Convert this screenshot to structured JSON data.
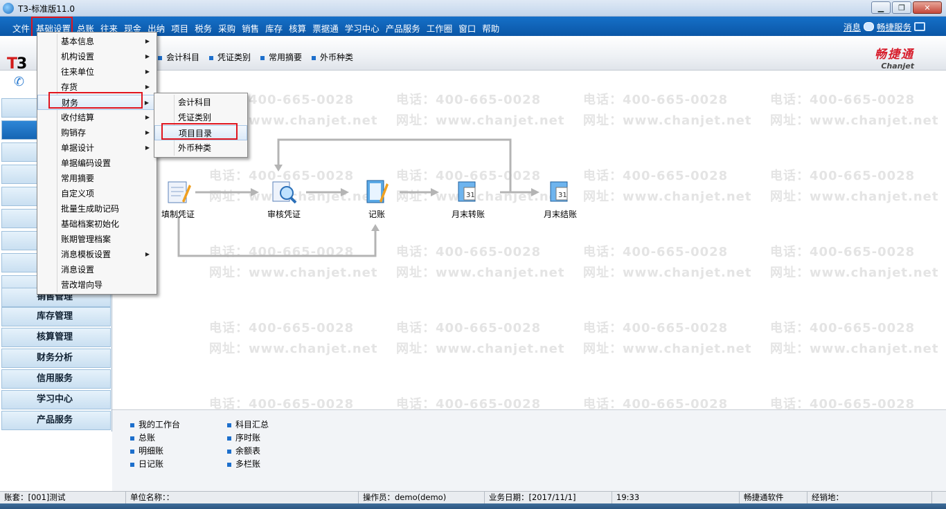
{
  "window": {
    "title": "T3-标准版11.0",
    "min": "▁",
    "max": "❐",
    "close": "✕"
  },
  "menubar": {
    "items": [
      "文件",
      "基础设置",
      "总账",
      "往来",
      "现金",
      "出纳",
      "项目",
      "税务",
      "采购",
      "销售",
      "库存",
      "核算",
      "票据通",
      "学习中心",
      "产品服务",
      "工作圈",
      "窗口",
      "帮助"
    ],
    "messages": "消息",
    "service": "畅捷服务"
  },
  "toolbar": {
    "items": [
      "会计科目",
      "凭证类别",
      "常用摘要",
      "外币种类"
    ],
    "brand_cn": "畅捷通",
    "brand_en": "Chanjet",
    "logo_t": "T",
    "logo_3": "3"
  },
  "sidebar": {
    "items": [
      "销售管理",
      "库存管理",
      "核算管理",
      "财务分析",
      "信用服务",
      "学习中心",
      "产品服务"
    ]
  },
  "dropdown": {
    "items": [
      {
        "label": "基本信息",
        "sub": true
      },
      {
        "label": "机构设置",
        "sub": true
      },
      {
        "label": "往来单位",
        "sub": true
      },
      {
        "label": "存货",
        "sub": true
      },
      {
        "label": "财务",
        "sub": true
      },
      {
        "label": "收付结算",
        "sub": true
      },
      {
        "label": "购销存",
        "sub": true
      },
      {
        "label": "单据设计",
        "sub": true
      },
      {
        "label": "单据编码设置",
        "sub": false
      },
      {
        "label": "常用摘要",
        "sub": false
      },
      {
        "label": "自定义项",
        "sub": false
      },
      {
        "label": "批量生成助记码",
        "sub": false
      },
      {
        "label": "基础档案初始化",
        "sub": false
      },
      {
        "label": "账期管理档案",
        "sub": false
      },
      {
        "label": "消息模板设置",
        "sub": true
      },
      {
        "label": "消息设置",
        "sub": false
      },
      {
        "label": "营改增向导",
        "sub": false
      }
    ]
  },
  "submenu": {
    "items": [
      "会计科目",
      "凭证类别",
      "项目目录",
      "外币种类"
    ]
  },
  "flow": {
    "nodes": [
      "填制凭证",
      "审核凭证",
      "记账",
      "月末转账",
      "月末结账"
    ]
  },
  "bottom_links": {
    "col1": [
      "我的工作台",
      "总账",
      "明细账",
      "日记账"
    ],
    "col2": [
      "科目汇总",
      "序时账",
      "余额表",
      "多栏账"
    ]
  },
  "watermark": {
    "phone": "电话：400-665-0028",
    "url": "网址：www.chanjet.net"
  },
  "status": {
    "account": "账套：[001]测试",
    "unit": "单位名称：：",
    "operator": "操作员：demo(demo)",
    "date": "业务日期：[2017/11/1]",
    "time": "19:33",
    "brand": "畅捷通软件",
    "dealer": "经销地："
  },
  "colors": {
    "menubar": "#0b56a6",
    "highlight": "#e0141e",
    "accent": "#1d6fcc"
  }
}
